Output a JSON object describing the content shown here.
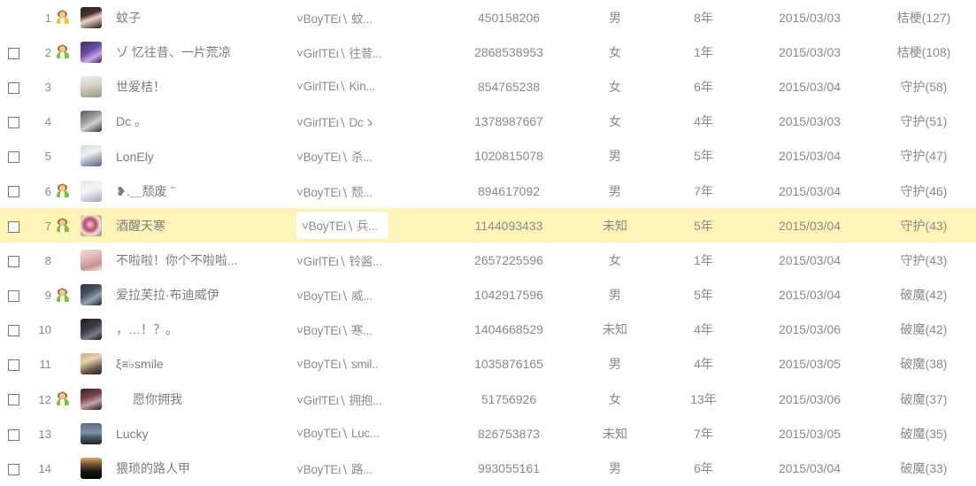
{
  "table": {
    "columns": [
      "select",
      "index",
      "rank-icon",
      "avatar",
      "nickname",
      "group_nickname",
      "qq_number",
      "gender",
      "qq_age",
      "join_date",
      "title_level"
    ],
    "highlighted_row_index": 7,
    "highlight_color": "#fff4b8",
    "text_color": "#7d7d7d",
    "rows": [
      {
        "index": "1",
        "checkbox": false,
        "rank_icon": "yellow",
        "avatar_style": "anime-dark-hair",
        "name": "蚊子",
        "group": "˅BoyTEι∖ 蚊...",
        "qq": "450158206",
        "gender": "男",
        "years": "8年",
        "date": "2015/03/03",
        "title": "桔梗(127)"
      },
      {
        "index": "2",
        "checkbox": true,
        "rank_icon": "green",
        "avatar_style": "purple-night",
        "name": "ゾ 忆往昔、一片荒凉",
        "group": "˅GirlTEι∖ 往昔...",
        "qq": "2868538953",
        "gender": "女",
        "years": "1年",
        "date": "2015/03/03",
        "title": "桔梗(108)"
      },
      {
        "index": "3",
        "checkbox": true,
        "rank_icon": "none",
        "avatar_style": "pale-blonde",
        "name": "世爱桔！",
        "group": "˅GirlTEι∖ Kin...",
        "qq": "854765238",
        "gender": "女",
        "years": "6年",
        "date": "2015/03/04",
        "title": "守护(58)"
      },
      {
        "index": "4",
        "checkbox": true,
        "rank_icon": "none",
        "avatar_style": "grey-photo",
        "name": "Dc 。",
        "group": "˅GirlTEι∖  Dcゝ",
        "qq": "1378987667",
        "gender": "女",
        "years": "4年",
        "date": "2015/03/03",
        "title": "守护(51)"
      },
      {
        "index": "5",
        "checkbox": true,
        "rank_icon": "none",
        "avatar_style": "white-hair",
        "name": "LonEly",
        "group": "˅BoyTEι∖ 杀...",
        "qq": "1020815078",
        "gender": "男",
        "years": "5年",
        "date": "2015/03/04",
        "title": "守护(47)"
      },
      {
        "index": "6",
        "checkbox": true,
        "rank_icon": "green",
        "avatar_style": "light-portrait",
        "name": "❥.＿颓废 ˝",
        "group": "˅BoyTEι∖ 颓...",
        "qq": "894617092",
        "gender": "男",
        "years": "7年",
        "date": "2015/03/04",
        "title": "守护(46)"
      },
      {
        "index": "7",
        "checkbox": true,
        "rank_icon": "green",
        "avatar_style": "pink-swirl",
        "name": "酒醒天寒",
        "group": "˅BoyTEι∖ 兵...",
        "qq": "1144093433",
        "gender": "未知",
        "years": "5年",
        "date": "2015/03/04",
        "title": "守护(43)"
      },
      {
        "index": "8",
        "checkbox": true,
        "rank_icon": "none",
        "avatar_style": "pink-girl",
        "name": "不啦啦！你个不啦啦...",
        "group": "˅GirlTEι∖ 铃酱...",
        "qq": "2657225596",
        "gender": "女",
        "years": "1年",
        "date": "2015/03/04",
        "title": "守护(43)"
      },
      {
        "index": "9",
        "checkbox": true,
        "rank_icon": "green",
        "avatar_style": "dark-anime",
        "name": "爱拉芙拉·布迪威伊",
        "group": "˅BoyTEι∖ 威...",
        "qq": "1042917596",
        "gender": "男",
        "years": "5年",
        "date": "2015/03/04",
        "title": "破魔(42)"
      },
      {
        "index": "10",
        "checkbox": true,
        "rank_icon": "none",
        "avatar_style": "dark-figure",
        "name": "，…！？。",
        "group": "˅BoyTEι∖ 寒...",
        "qq": "1404668529",
        "gender": "未知",
        "years": "4年",
        "date": "2015/03/06",
        "title": "破魔(42)"
      },
      {
        "index": "11",
        "checkbox": true,
        "rank_icon": "none",
        "avatar_style": "blond-photo",
        "name": "ξ≡♭smile",
        "group": "˅BoyTEι∖ smil..",
        "qq": "1035876165",
        "gender": "男",
        "years": "4年",
        "date": "2015/03/05",
        "title": "破魔(38)"
      },
      {
        "index": "12",
        "checkbox": true,
        "rank_icon": "green",
        "avatar_style": "maroon-dress",
        "name": "愿你拥我",
        "group": "˅GirlTEι∖ 拥抱...",
        "qq": "51756926",
        "gender": "女",
        "years": "13年",
        "date": "2015/03/06",
        "title": "破魔(37)"
      },
      {
        "index": "13",
        "checkbox": true,
        "rank_icon": "none",
        "avatar_style": "mountain-scene",
        "name": "Lucky",
        "group": "˅BoyTEι∖ Luc...",
        "qq": "826753873",
        "gender": "未知",
        "years": "7年",
        "date": "2015/03/05",
        "title": "破魔(35)"
      },
      {
        "index": "14",
        "checkbox": true,
        "rank_icon": "none",
        "avatar_style": "dark-road",
        "name": "猥琐的路人甲",
        "group": "˅BoyTEι∖ 路...",
        "qq": "993055161",
        "gender": "男",
        "years": "6年",
        "date": "2015/03/04",
        "title": "破魔(33)"
      }
    ]
  }
}
